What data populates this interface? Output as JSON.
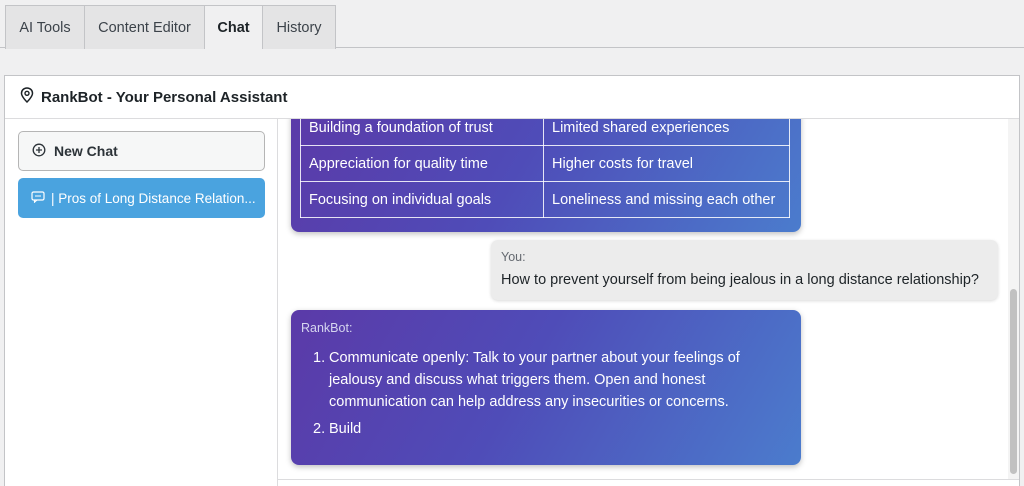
{
  "tabs": [
    {
      "label": "AI Tools",
      "active": false
    },
    {
      "label": "Content Editor",
      "active": false
    },
    {
      "label": "Chat",
      "active": true
    },
    {
      "label": "History",
      "active": false
    }
  ],
  "panel": {
    "title": "RankBot - Your Personal Assistant",
    "icon": "location-pin-icon"
  },
  "sidebar": {
    "new_chat_label": "New Chat",
    "new_chat_icon": "plus-circle-icon",
    "chat_items": [
      {
        "label": "| Pros of Long Distance Relation...",
        "icon": "chat-bubble-icon"
      }
    ]
  },
  "messages": {
    "table_rows": [
      [
        "Building a foundation of trust",
        "Limited shared experiences"
      ],
      [
        "Appreciation for quality time",
        "Higher costs for travel"
      ],
      [
        "Focusing on individual goals",
        "Loneliness and missing each other"
      ]
    ],
    "user": {
      "sender": "You:",
      "text": "How to prevent yourself from being jealous in a long distance relationship?"
    },
    "bot": {
      "sender": "RankBot:",
      "items": [
        {
          "num": "1.",
          "line1": "Communicate openly: Talk to your partner about your feelings of",
          "line2": "jealousy and discuss what triggers them. Open and honest",
          "line3": "communication can help address any insecurities or concerns."
        },
        {
          "num": "2.",
          "line1": "Build"
        }
      ]
    }
  },
  "colors": {
    "accent": "#4aa3df",
    "bot_gradient_start": "#5b3aa8",
    "bot_gradient_end": "#4b7ccd",
    "user_bubble": "#ececec"
  }
}
